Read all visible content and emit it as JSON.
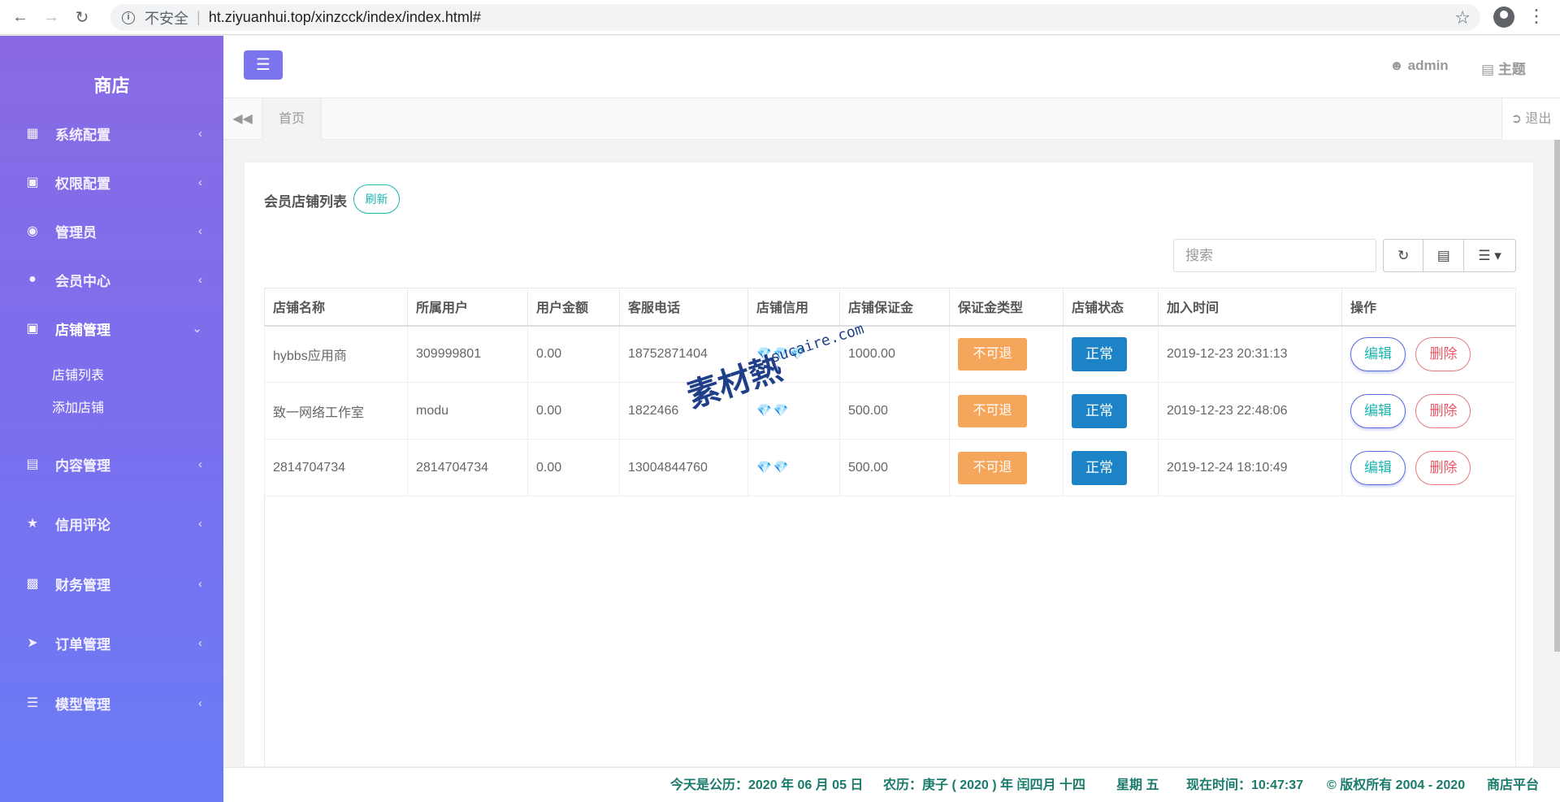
{
  "browser": {
    "insecure_label": "不安全",
    "url": "ht.ziyuanhui.top/xinzcck/index/index.html#"
  },
  "sidebar": {
    "brand": "商店",
    "items": [
      {
        "label": "系统配置",
        "icon": "grid-icon"
      },
      {
        "label": "权限配置",
        "icon": "lock-icon"
      },
      {
        "label": "管理员",
        "icon": "target-icon"
      },
      {
        "label": "会员中心",
        "icon": "user-icon"
      },
      {
        "label": "店铺管理",
        "icon": "store-icon",
        "expanded": true
      },
      {
        "label": "内容管理",
        "icon": "list-icon"
      },
      {
        "label": "信用评论",
        "icon": "star-icon"
      },
      {
        "label": "财务管理",
        "icon": "bars-icon"
      },
      {
        "label": "订单管理",
        "icon": "paper-plane-icon"
      },
      {
        "label": "模型管理",
        "icon": "server-icon"
      }
    ],
    "subitems": [
      "店铺列表",
      "添加店铺"
    ]
  },
  "topbar": {
    "user": "admin",
    "theme": "主题"
  },
  "tabs": {
    "home": "首页",
    "logout": "退出"
  },
  "panel": {
    "title": "会员店铺列表",
    "refresh": "刷新",
    "search_placeholder": "搜索"
  },
  "table": {
    "headers": [
      "店铺名称",
      "所属用户",
      "用户金额",
      "客服电话",
      "店铺信用",
      "店铺保证金",
      "保证金类型",
      "店铺状态",
      "加入时间",
      "操作"
    ],
    "rows": [
      {
        "name": "hybbs应用商",
        "user": "309999801",
        "amount": "0.00",
        "phone": "18752871404",
        "credit": "💎💎💎",
        "deposit": "1000.00",
        "deposit_type": "不可退",
        "status": "正常",
        "joined": "2019-12-23 20:31:13"
      },
      {
        "name": "致一网络工作室",
        "user": "modu",
        "amount": "0.00",
        "phone": "1822466",
        "credit": "💎💎",
        "deposit": "500.00",
        "deposit_type": "不可退",
        "status": "正常",
        "joined": "2019-12-23 22:48:06"
      },
      {
        "name": "2814704734",
        "user": "2814704734",
        "amount": "0.00",
        "phone": "13004844760",
        "credit": "💎💎",
        "deposit": "500.00",
        "deposit_type": "不可退",
        "status": "正常",
        "joined": "2019-12-24 18:10:49"
      }
    ],
    "edit_label": "编辑",
    "delete_label": "删除"
  },
  "watermark": {
    "big": "素材熱",
    "small": "sucaire.com"
  },
  "footer": {
    "date": "今天是公历：2020 年 06 月 05 日",
    "lunar": "农历：庚子 ( 2020 ) 年 闰四月 十四",
    "weekday": "星期 五",
    "time": "现在时间：10:47:37",
    "copyright": "© 版权所有 2004 - 2020",
    "platform": "商店平台"
  },
  "colors": {
    "sidebar_top": "#8a6ae4",
    "sidebar_bottom": "#6a7cf6",
    "accent": "#7c74ec",
    "teal": "#1cb5b0",
    "warning": "#f5a65a",
    "primary": "#1c84c6",
    "danger": "#ed5565"
  }
}
